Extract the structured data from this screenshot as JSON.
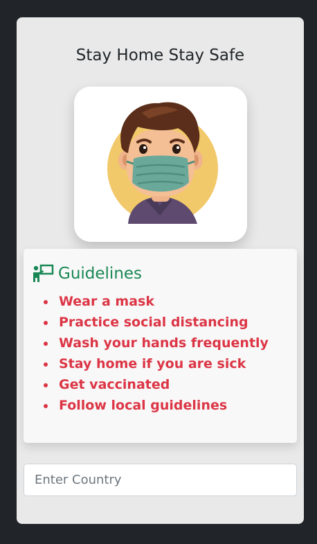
{
  "app": {
    "title": "Stay Home Stay Safe"
  },
  "guidelines": {
    "icon": "presenter-board-icon",
    "heading": "Guidelines",
    "items": [
      "Wear a mask",
      "Practice social distancing",
      "Wash your hands frequently",
      "Stay home if you are sick",
      "Get vaccinated",
      "Follow local guidelines"
    ]
  },
  "search": {
    "placeholder": "Enter Country",
    "value": ""
  },
  "colors": {
    "page_bg": "#212529",
    "card_bg": "#e9e9e9",
    "heading_green": "#198754",
    "list_red": "#dc3545"
  }
}
